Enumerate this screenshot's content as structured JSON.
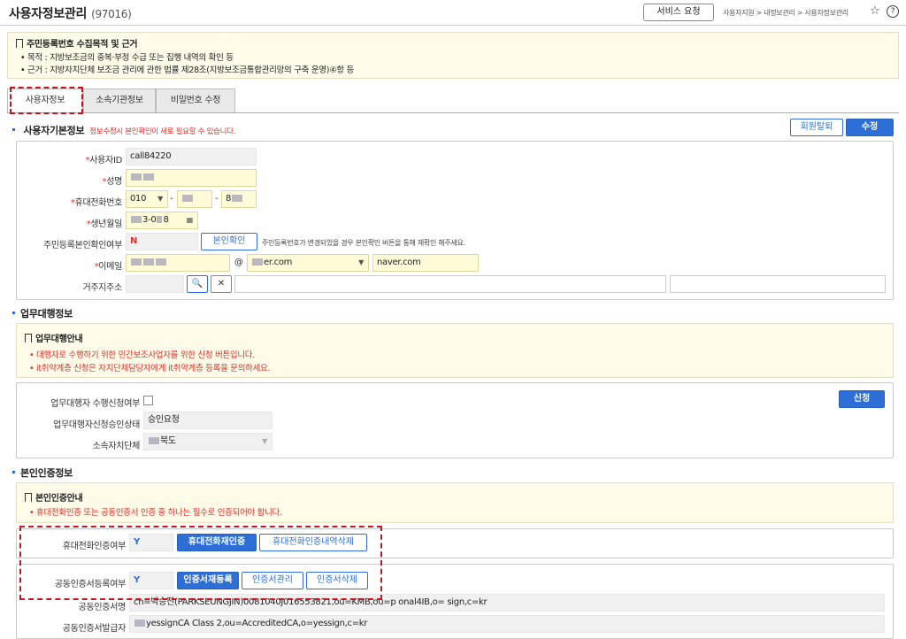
{
  "header": {
    "title": "사용자정보관리",
    "code": "(97016)",
    "service_button": "서비스 요청",
    "breadcrumb": "사용자지원 > 내정보관리 > 사용자정보관리",
    "star_icon": "☆",
    "help_icon": "?"
  },
  "purpose_notice": {
    "title": "주민등록번호 수집목적 및 근거",
    "lines": [
      "• 목적 : 지방보조금의 중복·부정 수급 또는 집행 내역의 확인 등",
      "• 근거 : 지방자치단체 보조금 관리에 관한 법률 제28조(지방보조금통합관리망의 구축 운영)④항 등"
    ]
  },
  "tabs": [
    "사용자정보",
    "소속기관정보",
    "비밀번호 수정"
  ],
  "basic_info": {
    "title": "사용자기본정보",
    "note": "정보수정시 본인확인이 새로 필요할 수 있습니다.",
    "withdraw_button": "회원탈퇴",
    "edit_button": "수정",
    "labels": {
      "user_id": "사용자ID",
      "name": "성명",
      "phone": "휴대전화번호",
      "birth": "생년월일",
      "rrn_verified": "주민등록본인확인여부",
      "email": "이메일",
      "address": "거주지주소"
    },
    "values": {
      "user_id": "call84220",
      "phone_prefix": "010",
      "phone_dash": "-",
      "birth": "3-0",
      "birth_tail": "8",
      "rrn_verified": "N",
      "email_at": "@",
      "email_domain": "er.com",
      "email_domain_input": "naver.com"
    },
    "verify_button": "본인확인",
    "verify_note": "주민등록번호가 변경되었을 경우 본인확인 버튼을 통해 재확인 해주세요.",
    "search_icon": "🔍",
    "clear_icon": "✕"
  },
  "agency": {
    "title": "업무대행정보",
    "notice_title": "업무대행안내",
    "notice_lines": [
      "• 대행자로 수행하기 위한 민간보조사업자를 위한 신청 버튼입니다.",
      "• it취약계층 신청은 자치단체담당자에게 it취약계층 등록을 문의하세요."
    ],
    "labels": {
      "apply_yn": "업무대행자 수행신청여부",
      "status": "업무대행자신청승인상태",
      "local_gov": "소속자치단체"
    },
    "values": {
      "status": "승인요청",
      "local_gov": "북도"
    },
    "apply_button": "신청"
  },
  "identity": {
    "title": "본인인증정보",
    "notice_title": "본인인증안내",
    "notice_lines": [
      "• 휴대전화인증 또는 공동인증서 인증 중 하나는 필수로 인증되어야 합니다."
    ],
    "labels": {
      "phone_auth": "휴대전화인증여부",
      "cert_reg": "공동인증서등록여부",
      "cert_owner": "공동인증서명",
      "cert_issuer": "공동인증서발급자"
    },
    "values": {
      "phone_auth": "Y",
      "cert_reg": "Y",
      "cert_owner": "cn=박승진(PARKSEUNGJIN)0081040J016553821,ou=KMB,ou=p onal4IB,o= sign,c=kr",
      "cert_issuer": "yessignCA Class 2,ou=AccreditedCA,o=yessign,c=kr"
    },
    "buttons": {
      "phone_reauth": "휴대전화재인증",
      "phone_history_delete": "휴대전화인증내역삭제",
      "cert_reregister": "인증서재등록",
      "cert_manage": "인증서관리",
      "cert_delete": "인증서삭제"
    }
  }
}
